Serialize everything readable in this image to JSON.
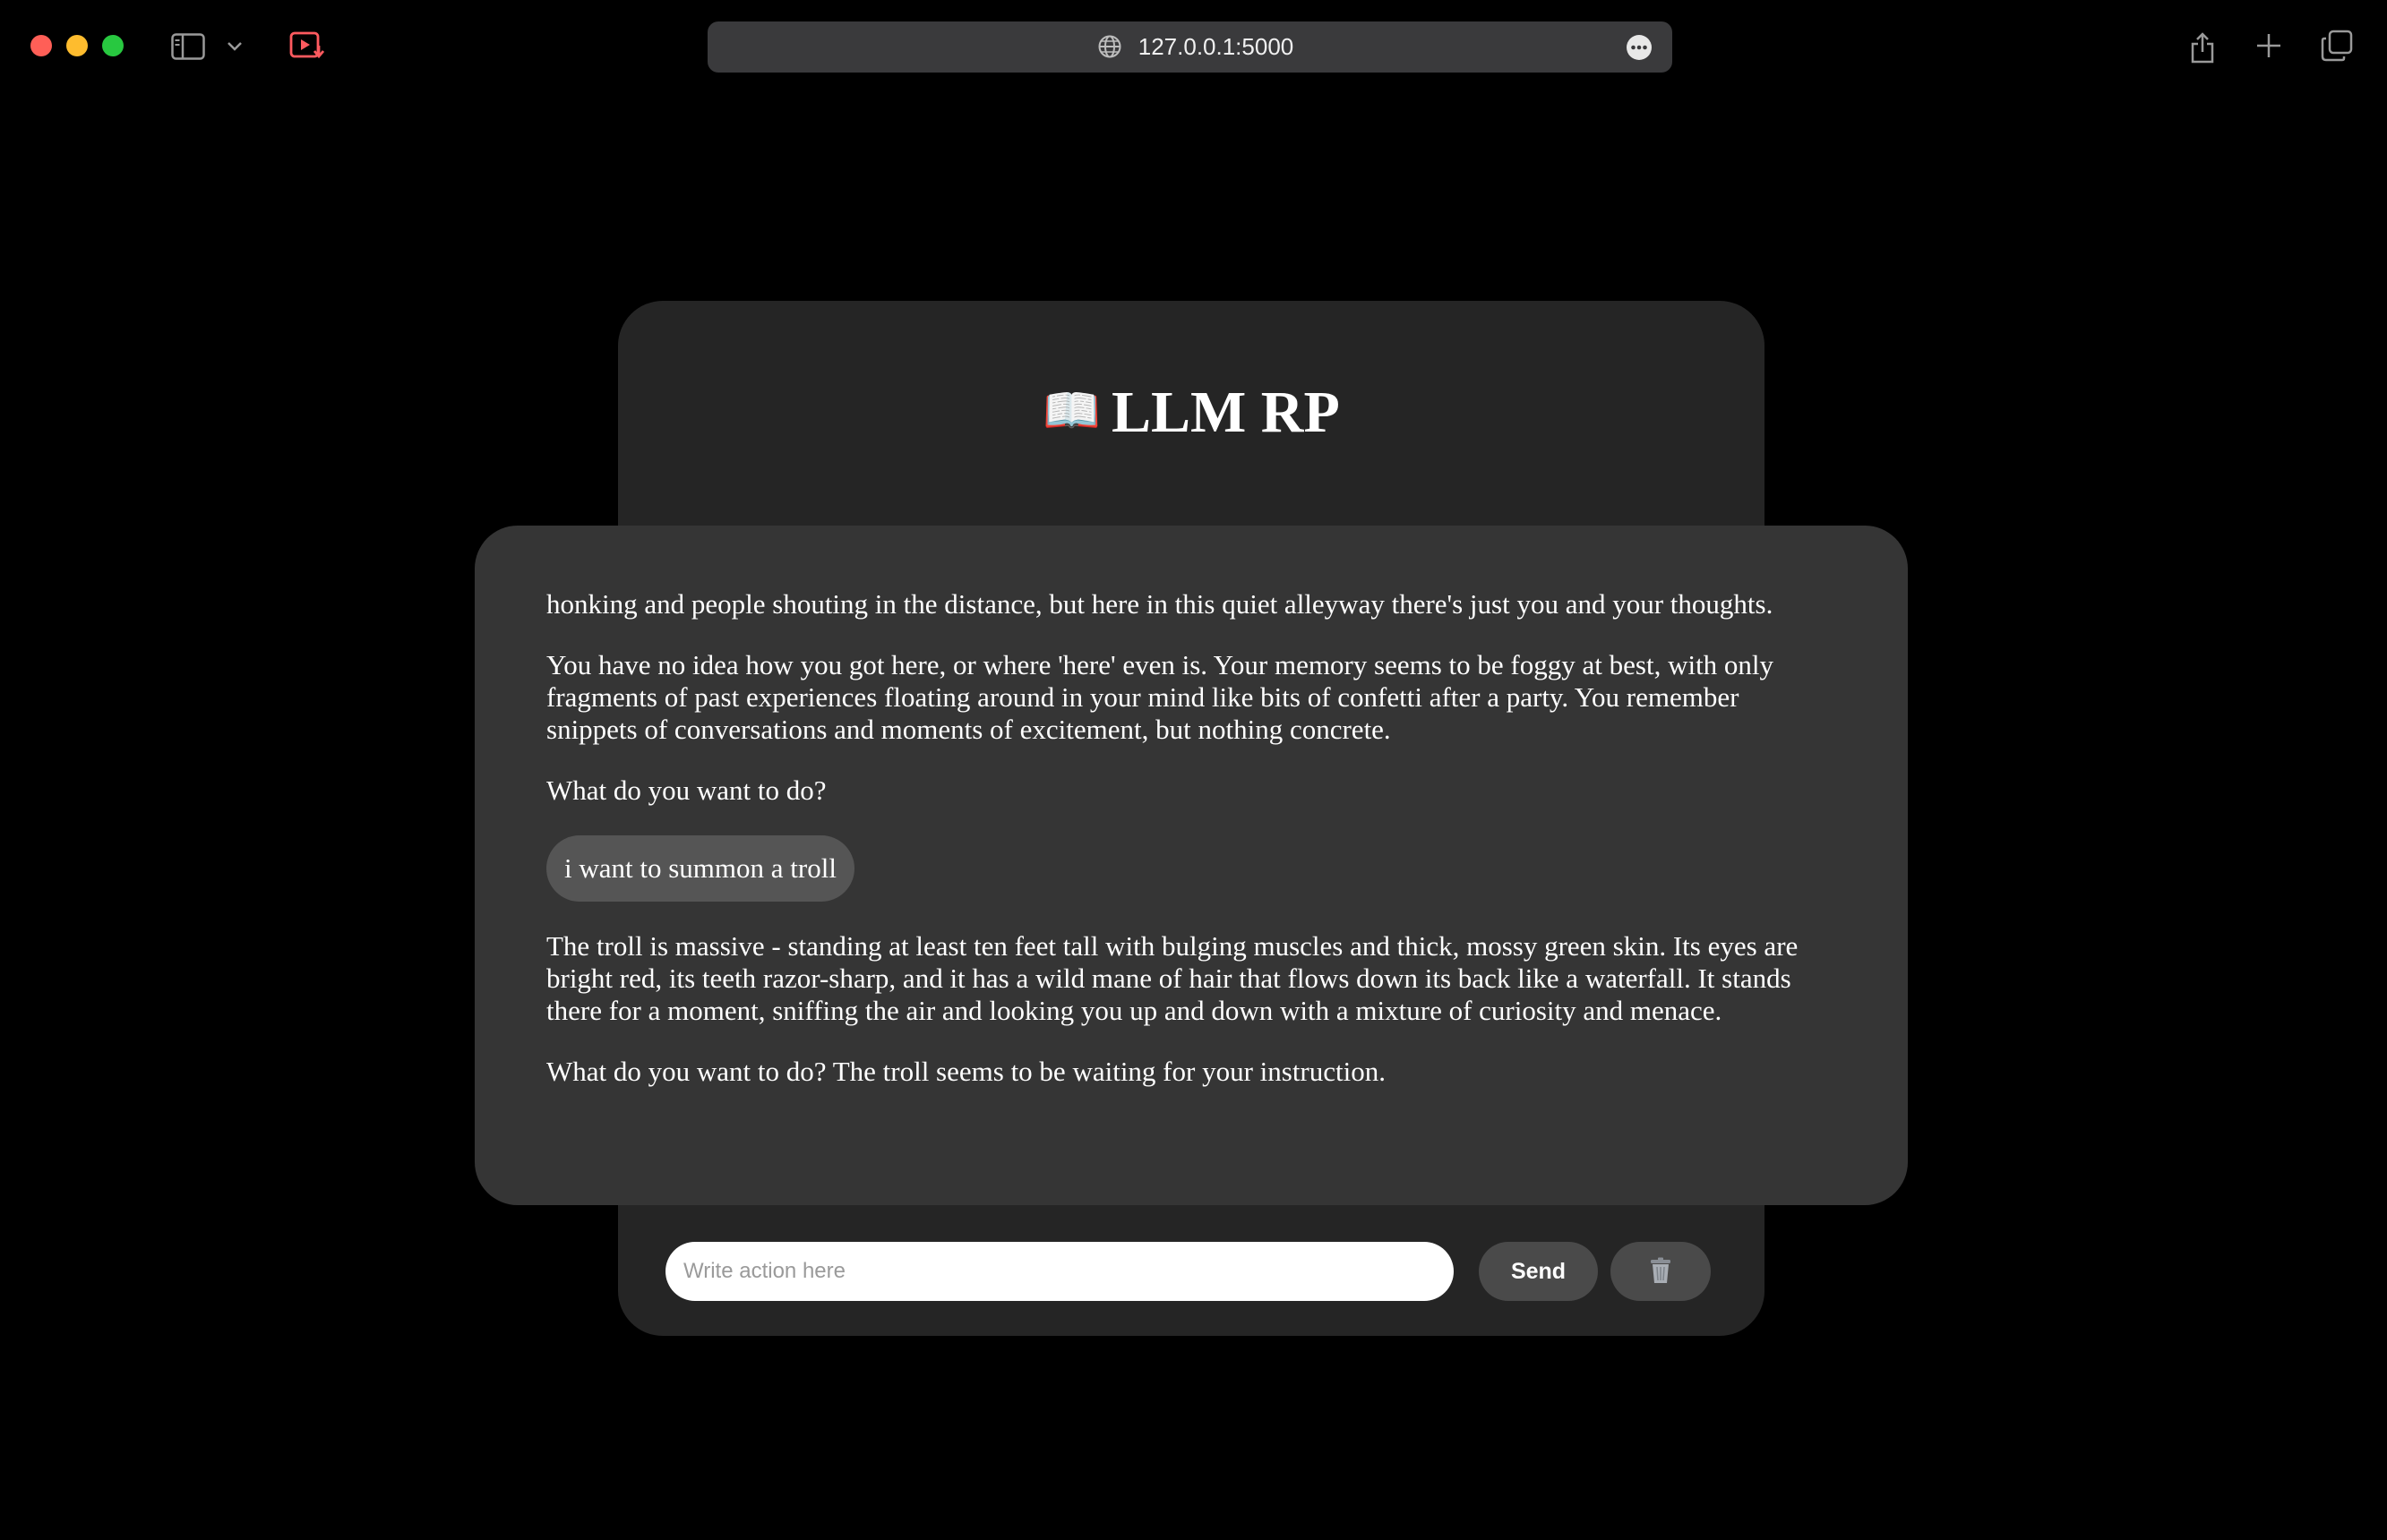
{
  "browser": {
    "url": "127.0.0.1:5000",
    "icons": [
      "sidebar-icon",
      "chevron-down-icon",
      "media-record-icon",
      "globe-icon",
      "more-icon",
      "share-icon",
      "plus-icon",
      "tabs-overview-icon"
    ]
  },
  "app": {
    "title_icon": "📖",
    "title": "LLM RP",
    "messages": [
      {
        "role": "assistant",
        "text": "honking and people shouting in the distance, but here in this quiet alleyway there's just you and your thoughts."
      },
      {
        "role": "assistant",
        "text": "You have no idea how you got here, or where 'here' even is. Your memory seems to be foggy at best, with only fragments of past experiences floating around in your mind like bits of confetti after a party. You remember snippets of conversations and moments of excitement, but nothing concrete."
      },
      {
        "role": "assistant",
        "text": "What do you want to do?"
      },
      {
        "role": "user",
        "text": "i want to summon a troll"
      },
      {
        "role": "assistant",
        "text": "The troll is massive - standing at least ten feet tall with bulging muscles and thick, mossy green skin. Its eyes are bright red, its teeth razor-sharp, and it has a wild mane of hair that flows down its back like a waterfall. It stands there for a moment, sniffing the air and looking you up and down with a mixture of curiosity and menace."
      },
      {
        "role": "assistant",
        "text": "What do you want to do? The troll seems to be waiting for your instruction."
      }
    ],
    "input": {
      "placeholder": "Write action here",
      "value": ""
    },
    "send_label": "Send",
    "clear_icon": "trash-icon"
  },
  "colors": {
    "background": "#000000",
    "card": "#252525",
    "chat": "#353535",
    "user_bubble": "#555555",
    "button": "#4a4a4a"
  }
}
